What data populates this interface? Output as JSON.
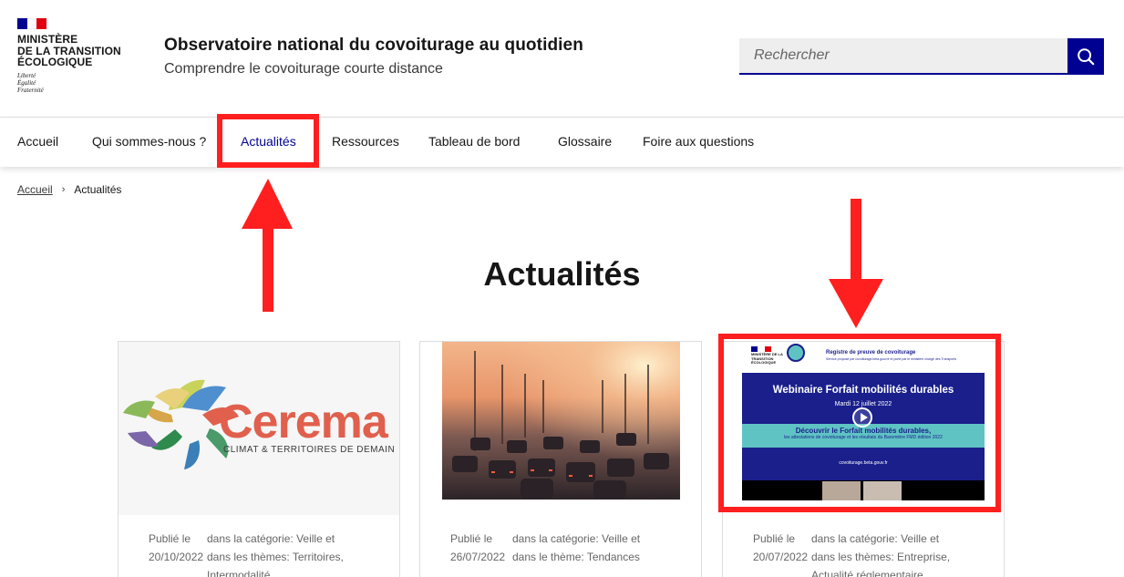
{
  "header": {
    "ministry_line1": "MINISTÈRE",
    "ministry_line2": "DE LA TRANSITION",
    "ministry_line3": "ÉCOLOGIQUE",
    "motto_line1": "Liberté",
    "motto_line2": "Égalité",
    "motto_line3": "Fraternité",
    "site_title": "Observatoire national du covoiturage au quotidien",
    "site_tagline": "Comprendre le covoiturage courte distance",
    "search_placeholder": "Rechercher"
  },
  "nav": {
    "items": [
      {
        "label": "Accueil"
      },
      {
        "label": "Qui sommes-nous ?"
      },
      {
        "label": "Actualités"
      },
      {
        "label": "Ressources"
      },
      {
        "label": "Tableau de bord"
      },
      {
        "label": "Glossaire"
      },
      {
        "label": "Foire aux questions"
      }
    ]
  },
  "breadcrumb": {
    "home": "Accueil",
    "current": "Actualités"
  },
  "page_title": "Actualités",
  "cards": [
    {
      "logo_word": "Cerema",
      "logo_tagline": "CLIMAT & TERRITOIRES DE DEMAIN",
      "published_label": "Publié le",
      "date": "20/10/2022",
      "category": "dans la catégorie: Veille et",
      "themes_line1": "dans les thèmes: Territoires,",
      "themes_line2": "Intermodalité"
    },
    {
      "published_label": "Publié le",
      "date": "26/07/2022",
      "category": "dans la catégorie: Veille et",
      "themes_line1": "dans le thème: Tendances",
      "themes_line2": ""
    },
    {
      "webinar_ministry": "MINISTÈRE DE LA TRANSITION ÉCOLOGIQUE",
      "webinar_register": "Registre de preuve de covoiturage",
      "webinar_service": "Service proposé par covoiturage.beta.gouv.fr et porté par le ministère chargé des Transports",
      "webinar_title": "Webinaire Forfait mobilités durables",
      "webinar_date": "Mardi 12 juillet 2022",
      "webinar_sub1": "Découvrir le Forfait mobilités durables,",
      "webinar_sub2": "les attestations de covoiturage et les résultats du Baromètre FMD édition 2022",
      "webinar_url": "covoiturage.beta.gouv.fr",
      "published_label": "Publié le",
      "date": "20/07/2022",
      "category": "dans la catégorie: Veille et",
      "themes_line1": "dans les thèmes: Entreprise,",
      "themes_line2": "Actualité réglementaire,"
    }
  ],
  "colors": {
    "brand_blue": "#000091",
    "marianne_red": "#e1000f",
    "annotation_red": "#ff1f1f",
    "cerema_orange": "#e0604d",
    "webinar_navy": "#1a1f8c",
    "webinar_teal": "#5fc3c4"
  },
  "icons": {
    "search": "search-icon",
    "chevron": "chevron-right-icon",
    "play": "play-icon",
    "arrow": "arrow-annotation"
  }
}
